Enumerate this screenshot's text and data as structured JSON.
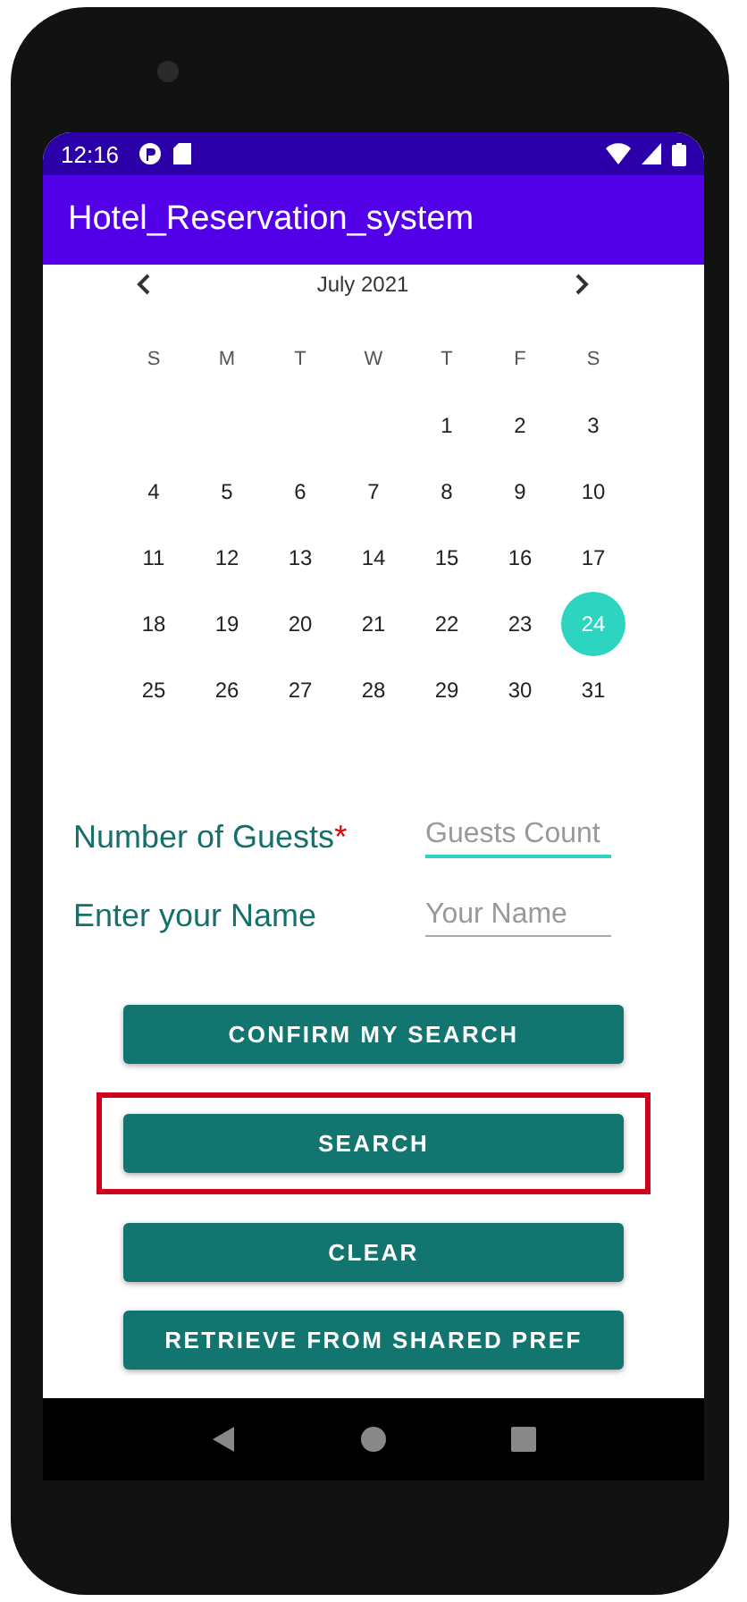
{
  "status_bar": {
    "time": "12:16"
  },
  "app_bar": {
    "title": "Hotel_Reservation_system"
  },
  "calendar": {
    "month": "July 2021",
    "weekdays": [
      "S",
      "M",
      "T",
      "W",
      "T",
      "F",
      "S"
    ],
    "weeks": [
      [
        {
          "day": "1",
          "selected": false
        },
        {
          "day": "2",
          "selected": false
        },
        {
          "day": "3",
          "selected": false
        }
      ],
      [
        {
          "day": "4",
          "selected": false
        },
        {
          "day": "5",
          "selected": false
        },
        {
          "day": "6",
          "selected": false
        },
        {
          "day": "7",
          "selected": false
        },
        {
          "day": "8",
          "selected": false
        },
        {
          "day": "9",
          "selected": false
        },
        {
          "day": "10",
          "selected": false
        }
      ],
      [
        {
          "day": "11",
          "selected": false
        },
        {
          "day": "12",
          "selected": false
        },
        {
          "day": "13",
          "selected": false
        },
        {
          "day": "14",
          "selected": false
        },
        {
          "day": "15",
          "selected": false
        },
        {
          "day": "16",
          "selected": false
        },
        {
          "day": "17",
          "selected": false
        }
      ],
      [
        {
          "day": "18",
          "selected": false
        },
        {
          "day": "19",
          "selected": false
        },
        {
          "day": "20",
          "selected": false
        },
        {
          "day": "21",
          "selected": false
        },
        {
          "day": "22",
          "selected": false
        },
        {
          "day": "23",
          "selected": false
        },
        {
          "day": "24",
          "selected": true
        }
      ],
      [
        {
          "day": "25",
          "selected": false
        },
        {
          "day": "26",
          "selected": false
        },
        {
          "day": "27",
          "selected": false
        },
        {
          "day": "28",
          "selected": false
        },
        {
          "day": "29",
          "selected": false
        },
        {
          "day": "30",
          "selected": false
        },
        {
          "day": "31",
          "selected": false
        }
      ]
    ]
  },
  "form": [
    {
      "label": "Number of Guests",
      "required_mark": "*",
      "placeholder": "Guests Count",
      "focused": true
    },
    {
      "label": "Enter your Name",
      "placeholder": "Your Name",
      "focused": false
    }
  ],
  "buttons": [
    {
      "label": "CONFIRM MY SEARCH",
      "highlighted": false
    },
    {
      "label": "SEARCH",
      "highlighted": true
    },
    {
      "label": "CLEAR",
      "highlighted": false
    },
    {
      "label": "RETRIEVE FROM SHARED PREF",
      "highlighted": false
    }
  ]
}
